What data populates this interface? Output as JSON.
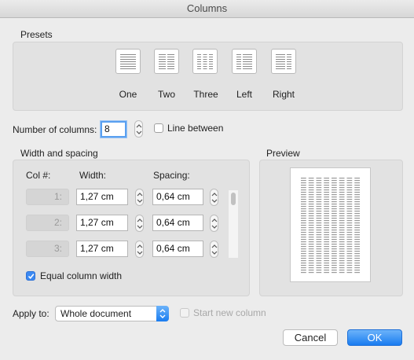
{
  "window": {
    "title": "Columns"
  },
  "presets": {
    "group_label": "Presets",
    "items": [
      {
        "label": "One",
        "icon": "one-column-icon"
      },
      {
        "label": "Two",
        "icon": "two-columns-icon"
      },
      {
        "label": "Three",
        "icon": "three-columns-icon"
      },
      {
        "label": "Left",
        "icon": "left-column-icon"
      },
      {
        "label": "Right",
        "icon": "right-column-icon"
      }
    ]
  },
  "number_of_columns": {
    "label": "Number of columns:",
    "value": "8"
  },
  "line_between": {
    "label": "Line between",
    "checked": false
  },
  "width_spacing": {
    "group_label": "Width and spacing",
    "col_header": "Col #:",
    "width_header": "Width:",
    "spacing_header": "Spacing:",
    "rows": [
      {
        "col": "1:",
        "width": "1,27 cm",
        "spacing": "0,64 cm"
      },
      {
        "col": "2:",
        "width": "1,27 cm",
        "spacing": "0,64 cm"
      },
      {
        "col": "3:",
        "width": "1,27 cm",
        "spacing": "0,64 cm"
      }
    ],
    "equal_width": {
      "label": "Equal column width",
      "checked": true
    }
  },
  "preview": {
    "group_label": "Preview",
    "columns": 8
  },
  "apply_to": {
    "label": "Apply to:",
    "value": "Whole document"
  },
  "start_new_column": {
    "label": "Start new column",
    "checked": false,
    "enabled": false
  },
  "buttons": {
    "cancel": "Cancel",
    "ok": "OK"
  },
  "colors": {
    "accent": "#3b89f2",
    "dialog_bg": "#ececec",
    "group_bg": "#e2e2e2"
  }
}
